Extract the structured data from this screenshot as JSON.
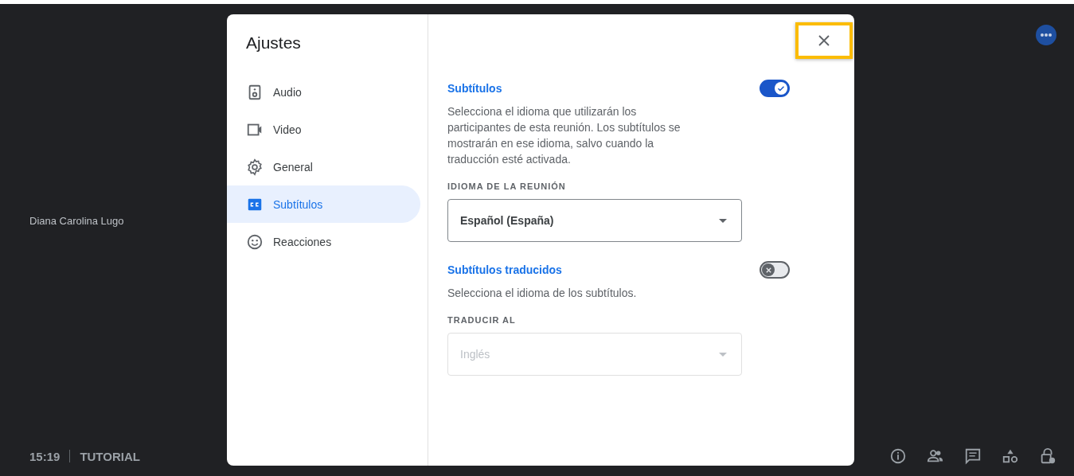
{
  "meeting": {
    "participant_name": "Diana Carolina Lugo",
    "time": "15:19",
    "title": "TUTORIAL"
  },
  "dialog": {
    "title": "Ajustes",
    "close_highlighted": true,
    "nav": [
      {
        "kind": "audio",
        "label": "Audio",
        "selected": false
      },
      {
        "kind": "video",
        "label": "Video",
        "selected": false
      },
      {
        "kind": "general",
        "label": "General",
        "selected": false
      },
      {
        "kind": "captions",
        "label": "Subtítulos",
        "selected": true
      },
      {
        "kind": "reactions",
        "label": "Reacciones",
        "selected": false
      }
    ],
    "sections": [
      {
        "title": "Subtítulos",
        "on": true,
        "description": "Selecciona el idioma que utilizarán los participantes de esta reunión. Los subtítulos se mostrarán en ese idioma, salvo cuando la traducción esté activada.",
        "field_label": "IDIOMA DE LA REUNIÓN",
        "select": {
          "value": "Español (España)",
          "disabled": false
        }
      },
      {
        "title": "Subtítulos traducidos",
        "on": false,
        "description": "Selecciona el idioma de los subtítulos.",
        "field_label": "TRADUCIR AL",
        "select": {
          "value": "Inglés",
          "disabled": true
        }
      }
    ]
  }
}
